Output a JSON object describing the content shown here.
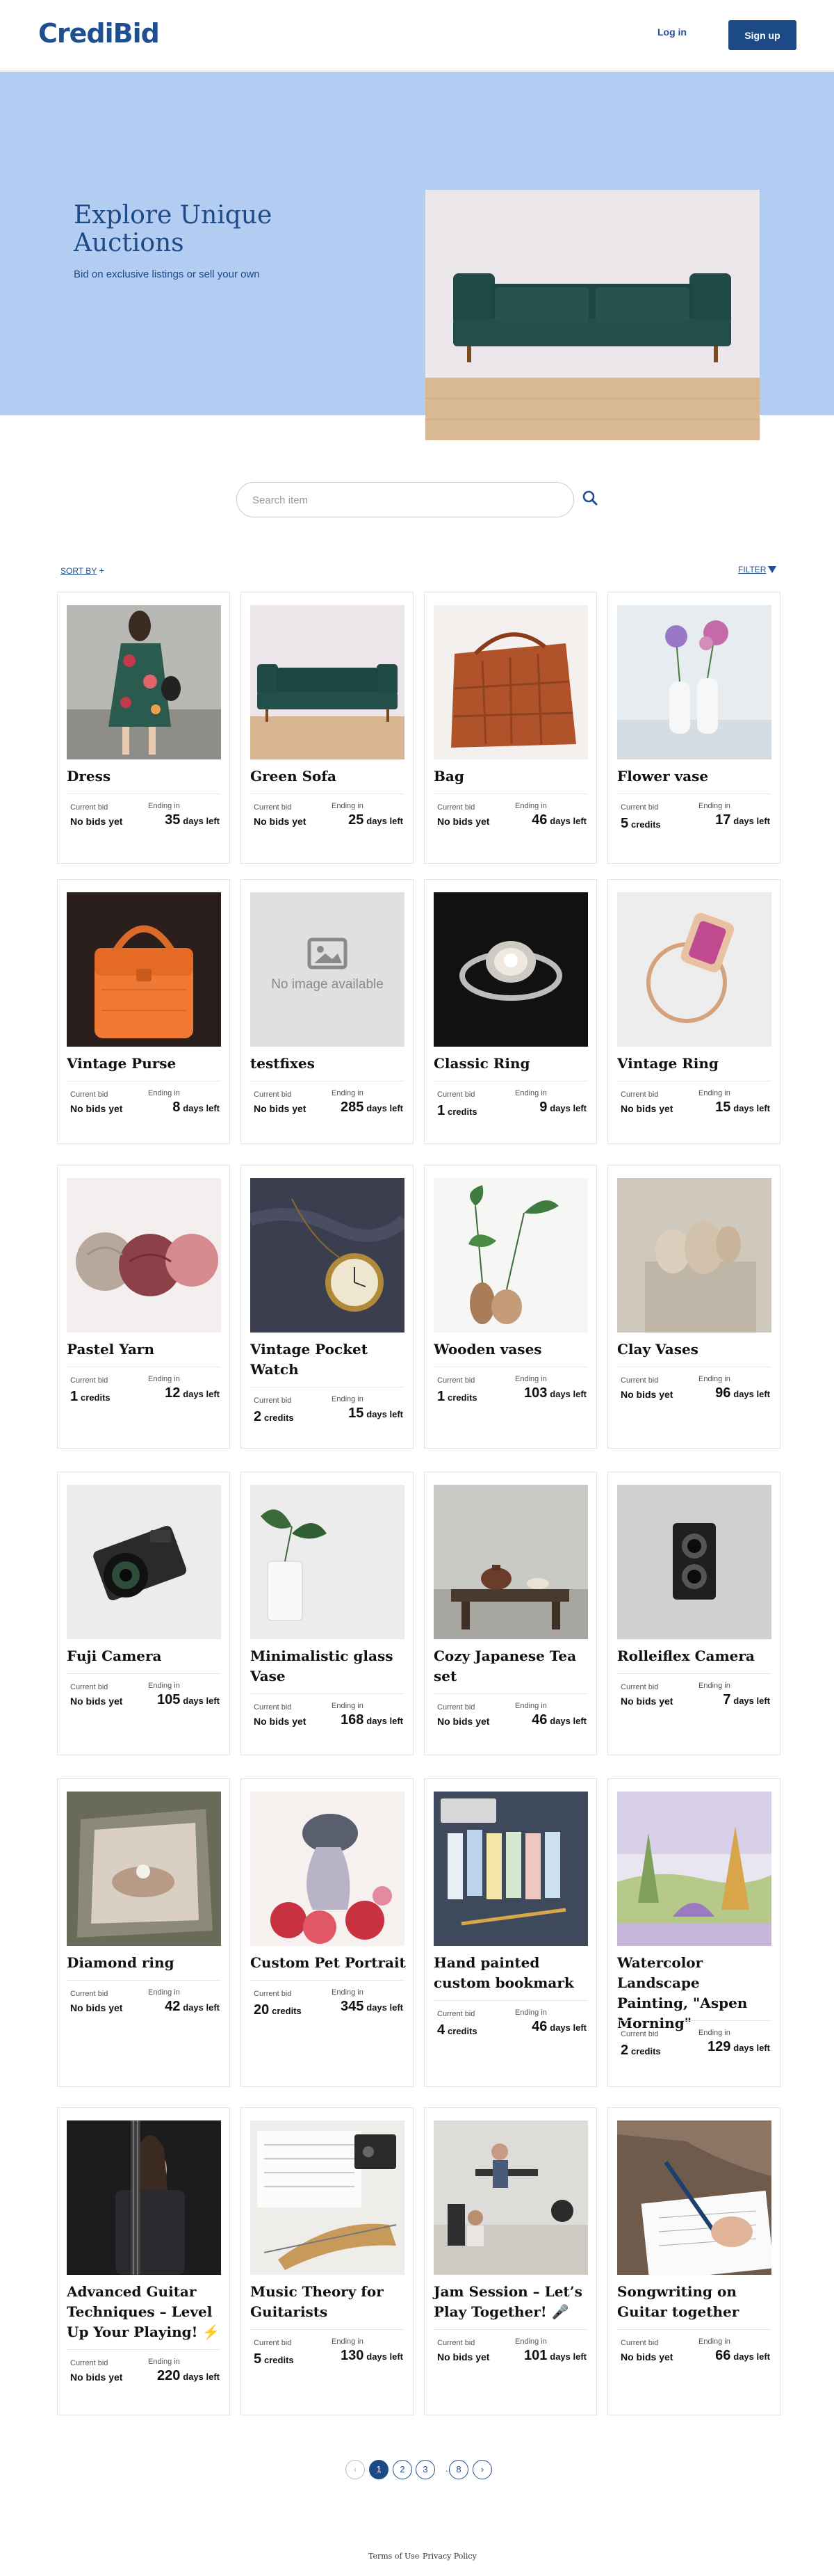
{
  "header": {
    "logo": "CrediBid",
    "login": "Log in",
    "signup": "Sign up"
  },
  "hero": {
    "title": "Explore Unique Auctions",
    "subtitle": "Bid on exclusive listings or sell your own"
  },
  "search": {
    "placeholder": "Search item"
  },
  "controls": {
    "sort": "SORT BY",
    "filter": "FILTER"
  },
  "labels": {
    "current_bid": "Current bid",
    "ending_in": "Ending in",
    "credits": "credits",
    "days_left": "days left",
    "no_bids": "No bids yet"
  },
  "items": [
    {
      "title": "Dress",
      "bid": "No bids yet",
      "days": "35",
      "image": "dress"
    },
    {
      "title": "Green Sofa",
      "bid": "No bids yet",
      "days": "25",
      "image": "sofa"
    },
    {
      "title": "Bag",
      "bid": "No bids yet",
      "days": "46",
      "image": "bag"
    },
    {
      "title": "Flower vase",
      "bid": "5",
      "days": "17",
      "image": "flower-vase"
    },
    {
      "title": "Vintage Purse",
      "bid": "No bids yet",
      "days": "8",
      "image": "purse"
    },
    {
      "title": "testfixes",
      "bid": "No bids yet",
      "days": "285",
      "image": "placeholder",
      "placeholder_text": "No image available"
    },
    {
      "title": "Classic Ring",
      "bid": "1",
      "days": "9",
      "image": "classic-ring"
    },
    {
      "title": "Vintage Ring",
      "bid": "No bids yet",
      "days": "15",
      "image": "vintage-ring"
    },
    {
      "title": "Pastel Yarn",
      "bid": "1",
      "days": "12",
      "image": "yarn"
    },
    {
      "title": "Vintage Pocket Watch",
      "bid": "2",
      "days": "15",
      "image": "pocket-watch"
    },
    {
      "title": "Wooden vases",
      "bid": "1",
      "days": "103",
      "image": "wooden-vases"
    },
    {
      "title": "Clay Vases",
      "bid": "No bids yet",
      "days": "96",
      "image": "clay-vases"
    },
    {
      "title": "Fuji Camera",
      "bid": "No bids yet",
      "days": "105",
      "image": "fuji-camera"
    },
    {
      "title": "Minimalistic glass Vase",
      "bid": "No bids yet",
      "days": "168",
      "image": "glass-vase"
    },
    {
      "title": "Cozy Japanese Tea set",
      "bid": "No bids yet",
      "days": "46",
      "image": "tea-set"
    },
    {
      "title": "Rolleiflex Camera",
      "bid": "No bids yet",
      "days": "7",
      "image": "rolleiflex"
    },
    {
      "title": "Diamond ring",
      "bid": "No bids yet",
      "days": "42",
      "image": "diamond-ring"
    },
    {
      "title": "Custom Pet Portrait",
      "bid": "20",
      "days": "345",
      "image": "pet-portrait"
    },
    {
      "title": "Hand painted custom bookmark",
      "bid": "4",
      "days": "46",
      "image": "bookmark"
    },
    {
      "title": "Watercolor Landscape Painting, \"Aspen Morning\"",
      "bid": "2",
      "days": "129",
      "image": "watercolor"
    },
    {
      "title": "Advanced Guitar Techniques – Level Up Your Playing! ⚡",
      "bid": "No bids yet",
      "days": "220",
      "image": "guitar"
    },
    {
      "title": "Music Theory for Guitarists",
      "bid": "5",
      "days": "130",
      "image": "music-theory"
    },
    {
      "title": "Jam Session – Let’s Play Together! 🎤",
      "bid": "No bids yet",
      "days": "101",
      "image": "jam-session"
    },
    {
      "title": "Songwriting on Guitar together",
      "bid": "No bids yet",
      "days": "66",
      "image": "songwriting"
    }
  ],
  "pagination": {
    "pages": [
      "1",
      "2",
      "3",
      "8"
    ],
    "current": "1",
    "ellipsis": "..."
  },
  "footer": {
    "terms": "Terms of Use",
    "privacy": "Privacy Policy"
  },
  "colors": {
    "brand": "#1b4a86",
    "hero_bg": "#b3cdf2"
  }
}
